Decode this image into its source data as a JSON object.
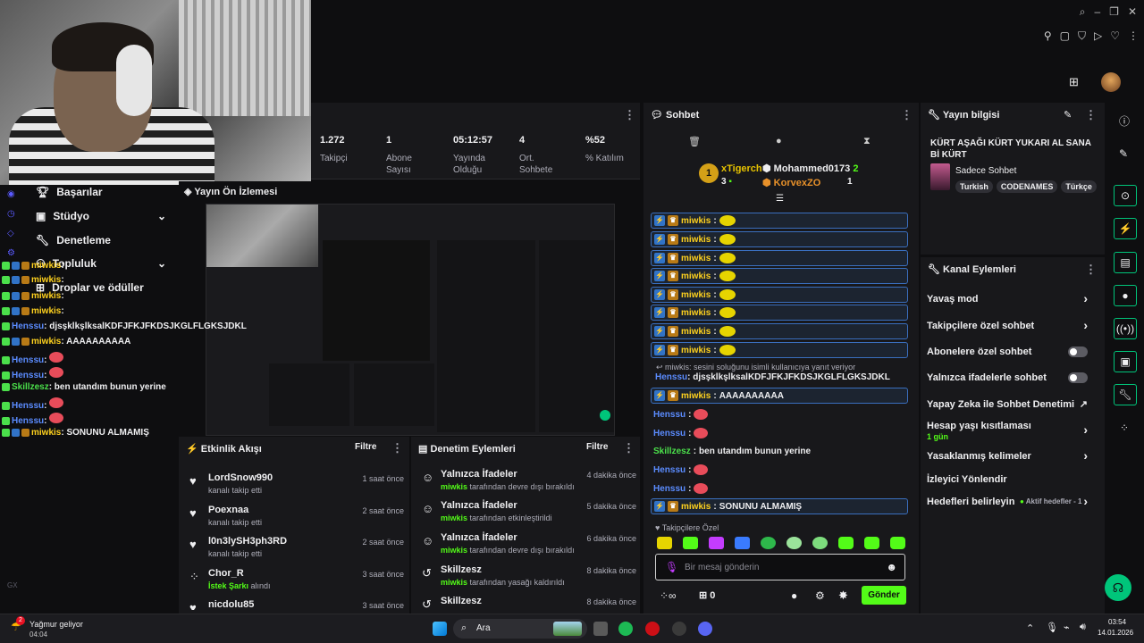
{
  "top_icons": [
    "search-icon",
    "minimize-icon",
    "restore-icon",
    "close-icon"
  ],
  "stats": [
    {
      "value": "1.272",
      "label": "Takipçi"
    },
    {
      "value": "1",
      "label": "Abone Sayısı"
    },
    {
      "value": "05:12:57",
      "label": "Yayında Olduğu"
    },
    {
      "value": "4",
      "label": "Ort. Sohbete"
    },
    {
      "value": "%52",
      "label": "% Katılım"
    }
  ],
  "left_nav": {
    "items": [
      {
        "label": "Başarılar"
      },
      {
        "label": "Stüdyo"
      },
      {
        "label": "Denetleme"
      },
      {
        "label": "Topluluk"
      },
      {
        "label": "Droplar ve ödüller"
      }
    ]
  },
  "preview": {
    "title": "Yayın Ön İzlemesi"
  },
  "overlay_chat": [
    {
      "user": "miwkis",
      "text": ":",
      "color": "#ffd21e"
    },
    {
      "user": "miwkis",
      "text": ":",
      "color": "#ffd21e"
    },
    {
      "user": "miwkis",
      "text": ":",
      "color": "#ffd21e"
    },
    {
      "user": "miwkis",
      "text": ":",
      "color": "#ffd21e"
    },
    {
      "user": "Henssu",
      "text": ": djsşklkşlksalKDFJFKJFKDSJKGLFLGKSJDKL",
      "color": "#5b8cff"
    },
    {
      "user": "miwkis",
      "text": ": AAAAAAAAAA",
      "color": "#ffd21e"
    },
    {
      "user": "Henssu",
      "text": ":",
      "color": "#5b8cff"
    },
    {
      "user": "Henssu",
      "text": ":",
      "color": "#5b8cff"
    },
    {
      "user": "Skillzesz",
      "text": ": ben utandım bunun yerine",
      "color": "#4be04b"
    },
    {
      "user": "Henssu",
      "text": ":",
      "color": "#5b8cff"
    },
    {
      "user": "Henssu",
      "text": ":",
      "color": "#5b8cff"
    },
    {
      "user": "miwkis",
      "text": ": SONUNU ALMAMIŞ",
      "color": "#ffd21e"
    }
  ],
  "activity_feed": {
    "title": "Etkinlik Akışı",
    "filter": "Filtre",
    "items": [
      {
        "name": "LordSnow990",
        "sub": "kanalı takip etti",
        "time": "1 saat önce"
      },
      {
        "name": "Poexnaa",
        "sub": "kanalı takip etti",
        "time": "2 saat önce"
      },
      {
        "name": "l0n3lySH3ph3RD",
        "sub": "kanalı takip etti",
        "time": "2 saat önce"
      },
      {
        "name": "Chor_R",
        "sub_highlight": "İstek Şarkı",
        "sub": " alındı",
        "time": "3 saat önce"
      },
      {
        "name": "nicdolu85",
        "sub": "",
        "time": "3 saat önce"
      }
    ]
  },
  "mod_actions": {
    "title": "Denetim Eylemleri",
    "filter": "Filtre",
    "items": [
      {
        "title": "Yalnızca İfadeler",
        "user": "miwkis",
        "sub": " tarafından devre dışı bırakıldı",
        "time": "4 dakika önce"
      },
      {
        "title": "Yalnızca İfadeler",
        "user": "miwkis",
        "sub": " tarafından etkinleştirildi",
        "time": "5 dakika önce"
      },
      {
        "title": "Yalnızca İfadeler",
        "user": "miwkis",
        "sub": " tarafından devre dışı bırakıldı",
        "time": "6 dakika önce"
      },
      {
        "title": "Skillzesz",
        "user": "miwkis",
        "sub": " tarafından yasağı kaldırıldı",
        "time": "8 dakika önce"
      },
      {
        "title": "Skillzesz",
        "user": "",
        "sub": "",
        "time": "8 dakika önce"
      }
    ]
  },
  "chat": {
    "title": "Sohbet",
    "leaderboard": {
      "first": "xTigerch",
      "first_count": "3",
      "second": "Mohammed0173",
      "second_count": "2",
      "third": "KorvexZO",
      "third_count": "1",
      "rank": "1"
    },
    "reply_hint": "miwkis: sesini soluğunu isimli kullanıcıya yanıt veriyor",
    "messages": [
      {
        "user": "miwkis",
        "text": "",
        "emote": "yellow"
      },
      {
        "user": "miwkis",
        "text": "",
        "emote": "yellow"
      },
      {
        "user": "miwkis",
        "text": "",
        "emote": "yellow"
      },
      {
        "user": "miwkis",
        "text": "",
        "emote": "yellow"
      },
      {
        "user": "miwkis",
        "text": "",
        "emote": "yellow"
      },
      {
        "user": "miwkis",
        "text": "",
        "emote": "yellow"
      },
      {
        "user": "miwkis",
        "text": "",
        "emote": "yellow"
      },
      {
        "user": "miwkis",
        "text": "",
        "emote": "yellow"
      }
    ],
    "henssu_long": "djsşklkşlksalKDFJFKJFKDSJKGLFLGKSJDKL",
    "miwkis_aaa": "AAAAAAAAAA",
    "skillzesz_text": "ben utandım bunun yerine",
    "miwkis_last": "SONUNU ALMAMIŞ",
    "followers_only": "Takipçilere Özel",
    "input_placeholder": "Bir mesaj gönderin",
    "points": "0",
    "send": "Gönder"
  },
  "stream_info": {
    "title": "Yayın bilgisi",
    "stream_title": "KÜRT AŞAĞI KÜRT YUKARI AL SANA Bİ KÜRT",
    "category": "Sadece Sohbet",
    "tags": [
      "Turkish",
      "CODENAMES",
      "Türkçe"
    ]
  },
  "channel_actions": {
    "title": "Kanal Eylemleri",
    "slow_mode": "Yavaş mod",
    "followers_chat": "Takipçilere özel sohbet",
    "subs_chat": "Abonelere özel sohbet",
    "emote_chat": "Yalnızca ifadelerle sohbet",
    "ai_mod": "Yapay Zeka ile Sohbet Denetimi",
    "age_limit": "Hesap yaşı kısıtlaması",
    "age_value": "1 gün",
    "banned_words": "Yasaklanmış kelimeler",
    "viewer_redirect": "İzleyici Yönlendir",
    "goals": "Hedefleri belirleyin",
    "goals_status": "Aktif hedefler - 1"
  },
  "taskbar": {
    "weather": "Yağmur geliyor",
    "weather_sub": "04:04",
    "search": "Ara",
    "time": "03:54",
    "date": "14.01.2026",
    "weather_badge": "2"
  },
  "colors": {
    "accent": "#53fc18",
    "bg": "#0e0e10",
    "panel": "#18181b"
  }
}
